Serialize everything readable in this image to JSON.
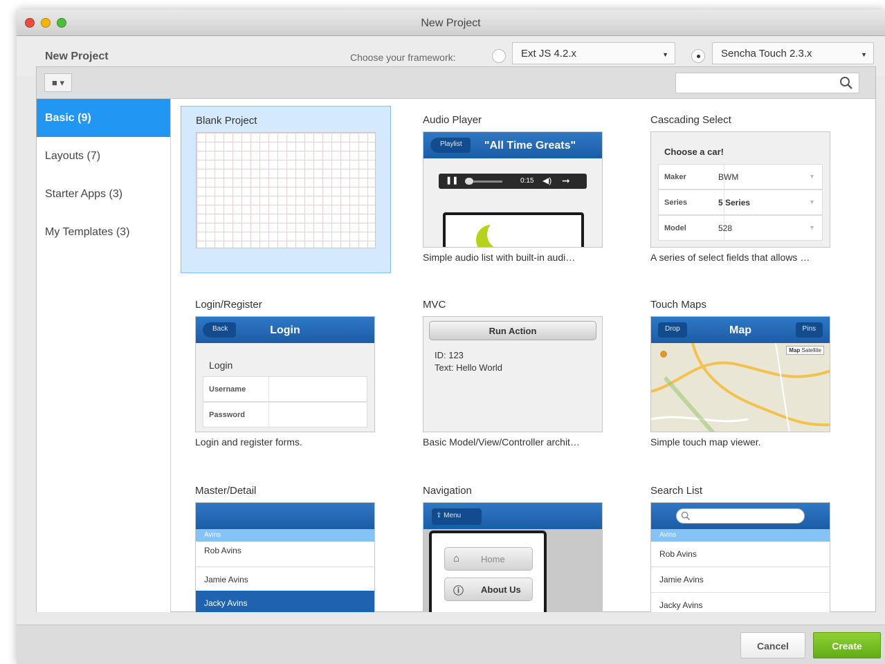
{
  "window": {
    "title": "New Project"
  },
  "header": {
    "title": "New Project",
    "framework_label": "Choose your framework:",
    "framework_options": [
      "Ext JS 4.2.x",
      "Sencha Touch 2.3.x"
    ],
    "selected_framework": "Sencha Touch 2.3.x"
  },
  "search": {
    "value": ""
  },
  "sidebar": {
    "items": [
      {
        "label": "Basic (9)",
        "active": true
      },
      {
        "label": "Layouts (7)",
        "active": false
      },
      {
        "label": "Starter Apps (3)",
        "active": false
      },
      {
        "label": "My Templates (3)",
        "active": false
      }
    ]
  },
  "templates": [
    {
      "title": "Blank Project",
      "desc": "",
      "selected": true
    },
    {
      "title": "Audio Player",
      "desc": "Simple audio list with built-in audi…"
    },
    {
      "title": "Cascading Select",
      "desc": "A series of select fields that allows …"
    },
    {
      "title": "Login/Register",
      "desc": "Login and register forms."
    },
    {
      "title": "MVC",
      "desc": "Basic Model/View/Controller archit…"
    },
    {
      "title": "Touch Maps",
      "desc": "Simple touch map viewer."
    },
    {
      "title": "Master/Detail",
      "desc": ""
    },
    {
      "title": "Navigation",
      "desc": ""
    },
    {
      "title": "Search List",
      "desc": ""
    }
  ],
  "previews": {
    "audio": {
      "back": "Playlist",
      "title": "\"All Time Greats\"",
      "time": "0:15"
    },
    "cascade": {
      "heading": "Choose a car!",
      "rows": [
        {
          "label": "Maker",
          "value": "BWM"
        },
        {
          "label": "Series",
          "value": "5 Series"
        },
        {
          "label": "Model",
          "value": "528"
        }
      ]
    },
    "login": {
      "back": "Back",
      "title": "Login",
      "section": "Login",
      "fields": [
        "Username",
        "Password"
      ]
    },
    "mvc": {
      "button": "Run Action",
      "id_line": "ID: 123",
      "text_line": "Text: Hello World"
    },
    "maps": {
      "left": "Drop",
      "title": "Map",
      "right": "Pins",
      "type_map": "Map",
      "type_sat": "Satellite"
    },
    "master": {
      "group": "Avins",
      "rows": [
        "Rob Avins",
        "Jamie Avins",
        "Jacky Avins"
      ]
    },
    "nav": {
      "menu": "Menu",
      "items": [
        "Home",
        "About Us"
      ]
    },
    "searchlist": {
      "group": "Avins",
      "rows": [
        "Rob Avins",
        "Jamie Avins",
        "Jacky Avins"
      ]
    }
  },
  "footer": {
    "cancel": "Cancel",
    "create": "Create"
  }
}
